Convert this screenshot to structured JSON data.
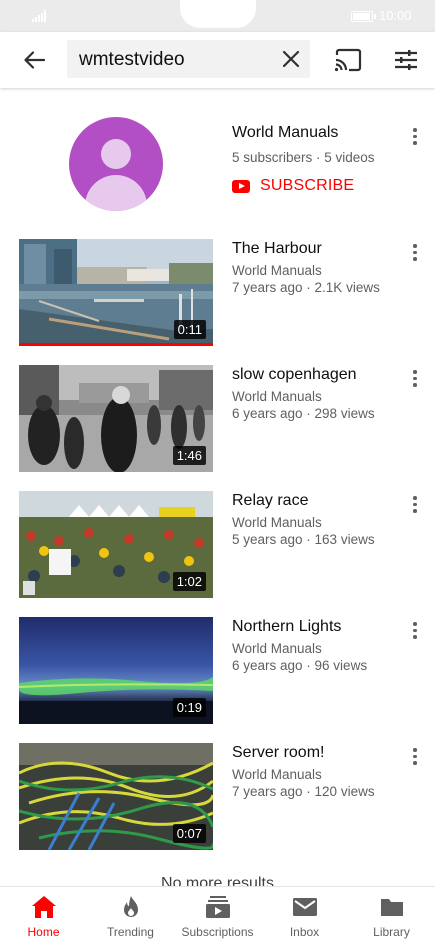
{
  "status_bar": {
    "time": "10:00",
    "battery_level": 0.85
  },
  "search": {
    "query": "wmtestvideo"
  },
  "channel": {
    "name": "World Manuals",
    "stats": "5 subscribers · 5 videos",
    "subscribe_label": "SUBSCRIBE"
  },
  "videos": [
    {
      "title": "The Harbour",
      "channel": "World Manuals",
      "meta": "7 years ago · 2.1K views",
      "duration": "0:11",
      "watched_fraction": 1.0
    },
    {
      "title": "slow copenhagen",
      "channel": "World Manuals",
      "meta": "6 years ago · 298 views",
      "duration": "1:46"
    },
    {
      "title": "Relay race",
      "channel": "World Manuals",
      "meta": "5 years ago · 163 views",
      "duration": "1:02"
    },
    {
      "title": "Northern Lights",
      "channel": "World Manuals",
      "meta": "6 years ago · 96 views",
      "duration": "0:19"
    },
    {
      "title": "Server room!",
      "channel": "World Manuals",
      "meta": "7 years ago · 120 views",
      "duration": "0:07"
    }
  ],
  "end_message": "No more results",
  "bottom_nav": [
    {
      "label": "Home",
      "icon": "home-icon",
      "active": true
    },
    {
      "label": "Trending",
      "icon": "flame-icon"
    },
    {
      "label": "Subscriptions",
      "icon": "subscriptions-icon"
    },
    {
      "label": "Inbox",
      "icon": "mail-icon"
    },
    {
      "label": "Library",
      "icon": "folder-icon"
    }
  ],
  "colors": {
    "accent": "#ff0000",
    "avatar": "#b34fc4",
    "secondary_text": "#606060"
  }
}
